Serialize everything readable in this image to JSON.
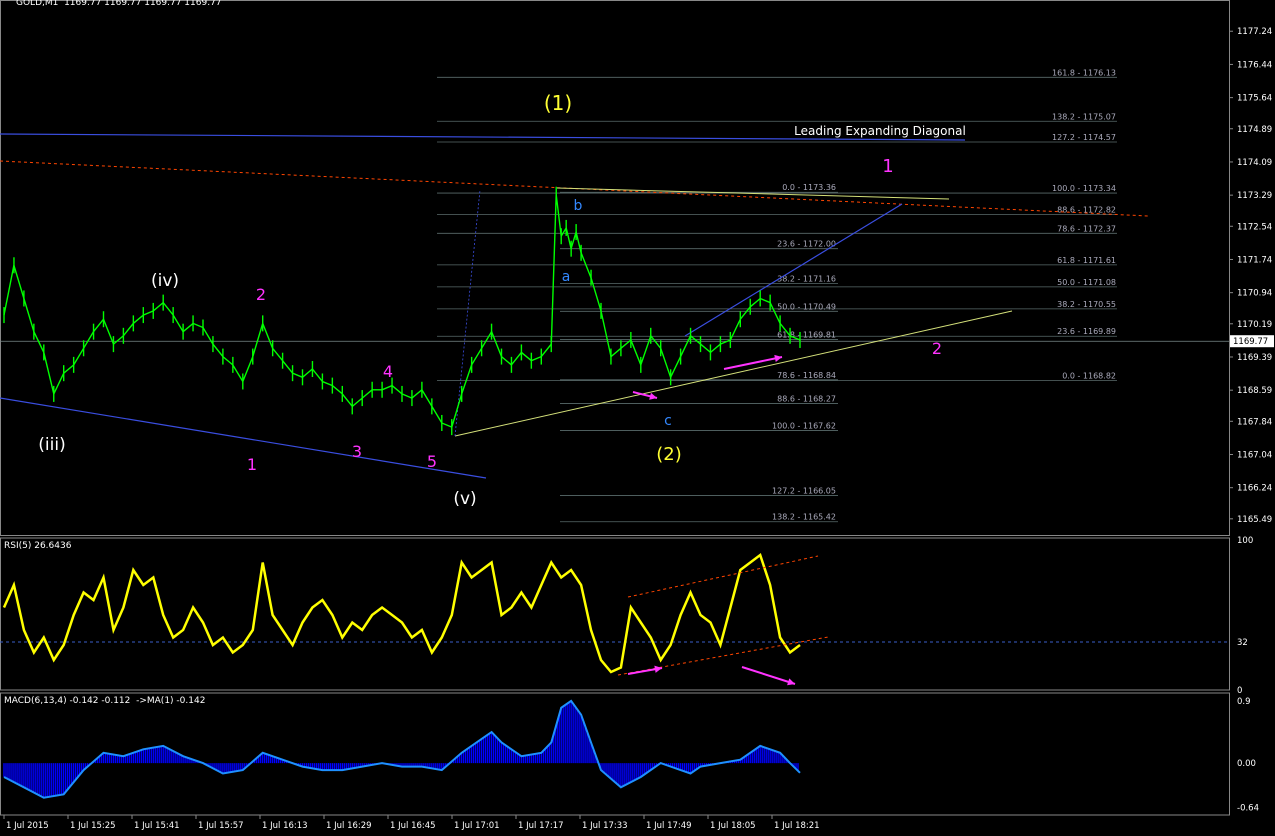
{
  "window": {
    "title": "GOLD,M1  1169.77 1169.77 1169.77 1169.77",
    "rsi_title": "RSI(5) 26.6436",
    "macd_title": "MACD(6,13,4) -0.142 -0.112  ->MA(1) -0.142"
  },
  "colors": {
    "background": "#000000",
    "candle": "#00ff00",
    "grid_fib": "#5a6b6b",
    "rsi_line": "#ffff00",
    "macd_hist": "#0000ff",
    "macd_signal": "#1e90ff",
    "trend_blue": "#3a4ee0",
    "trend_yellow": "#d4e07a",
    "trend_red_dotted": "#ff4500",
    "label_magenta": "#ff33ff",
    "label_yellow": "#ffff33",
    "label_white": "#ffffff",
    "label_blue": "#3388ff",
    "label_red": "#ff3300"
  },
  "chart_data": [
    {
      "type": "line",
      "panel": "price",
      "ylim": [
        1165.1,
        1177.8
      ],
      "y_ticks": [
        "1177.24",
        "1176.44",
        "1175.64",
        "1174.89",
        "1174.09",
        "1173.29",
        "1172.54",
        "1171.74",
        "1170.94",
        "1170.19",
        "1169.39",
        "1168.59",
        "1167.84",
        "1167.04",
        "1166.24",
        "1165.49"
      ],
      "last_price": "1169.77",
      "x_ticks": [
        "1 Jul 2015",
        "1 Jul 15:25",
        "1 Jul 15:41",
        "1 Jul 15:57",
        "1 Jul 16:13",
        "1 Jul 16:29",
        "1 Jul 16:45",
        "1 Jul 17:01",
        "1 Jul 17:17",
        "1 Jul 17:33",
        "1 Jul 17:49",
        "1 Jul 18:05",
        "1 Jul 18:21"
      ],
      "series": [
        {
          "points": [
            [
              0,
              1170.4
            ],
            [
              10,
              1171.6
            ],
            [
              20,
              1170.8
            ],
            [
              30,
              1170.0
            ],
            [
              40,
              1169.5
            ],
            [
              50,
              1168.5
            ],
            [
              60,
              1169.0
            ],
            [
              70,
              1169.2
            ],
            [
              80,
              1169.6
            ],
            [
              90,
              1170.0
            ],
            [
              100,
              1170.3
            ],
            [
              110,
              1169.7
            ],
            [
              120,
              1169.9
            ],
            [
              130,
              1170.2
            ],
            [
              140,
              1170.4
            ],
            [
              150,
              1170.5
            ],
            [
              160,
              1170.7
            ],
            [
              170,
              1170.4
            ],
            [
              180,
              1170.0
            ],
            [
              190,
              1170.2
            ],
            [
              200,
              1170.1
            ],
            [
              210,
              1169.7
            ],
            [
              220,
              1169.4
            ],
            [
              230,
              1169.2
            ],
            [
              240,
              1168.8
            ],
            [
              250,
              1169.4
            ],
            [
              260,
              1170.2
            ],
            [
              270,
              1169.6
            ],
            [
              280,
              1169.3
            ],
            [
              290,
              1169.0
            ],
            [
              300,
              1168.9
            ],
            [
              310,
              1169.1
            ],
            [
              320,
              1168.8
            ],
            [
              330,
              1168.7
            ],
            [
              340,
              1168.5
            ],
            [
              350,
              1168.2
            ],
            [
              360,
              1168.4
            ],
            [
              370,
              1168.6
            ],
            [
              380,
              1168.6
            ],
            [
              390,
              1168.7
            ],
            [
              400,
              1168.5
            ],
            [
              410,
              1168.4
            ],
            [
              420,
              1168.6
            ],
            [
              430,
              1168.2
            ],
            [
              440,
              1167.8
            ],
            [
              450,
              1167.7
            ],
            [
              460,
              1168.5
            ],
            [
              470,
              1169.2
            ],
            [
              480,
              1169.6
            ],
            [
              490,
              1170.0
            ],
            [
              500,
              1169.4
            ],
            [
              510,
              1169.2
            ],
            [
              520,
              1169.5
            ],
            [
              530,
              1169.3
            ],
            [
              540,
              1169.4
            ],
            [
              550,
              1169.7
            ],
            [
              555,
              1173.3
            ],
            [
              560,
              1172.3
            ],
            [
              565,
              1172.5
            ],
            [
              570,
              1172.0
            ],
            [
              575,
              1172.4
            ],
            [
              580,
              1171.9
            ],
            [
              590,
              1171.3
            ],
            [
              600,
              1170.5
            ],
            [
              610,
              1169.4
            ],
            [
              620,
              1169.6
            ],
            [
              630,
              1169.8
            ],
            [
              640,
              1169.2
            ],
            [
              650,
              1169.9
            ],
            [
              660,
              1169.6
            ],
            [
              670,
              1168.9
            ],
            [
              680,
              1169.4
            ],
            [
              690,
              1169.9
            ],
            [
              700,
              1169.7
            ],
            [
              710,
              1169.5
            ],
            [
              720,
              1169.7
            ],
            [
              730,
              1169.8
            ],
            [
              740,
              1170.3
            ],
            [
              750,
              1170.6
            ],
            [
              760,
              1170.8
            ],
            [
              770,
              1170.7
            ],
            [
              780,
              1170.2
            ],
            [
              790,
              1169.9
            ],
            [
              800,
              1169.8
            ]
          ]
        }
      ]
    },
    {
      "type": "line",
      "panel": "rsi",
      "title": "RSI(5) 26.6436",
      "ylim": [
        0,
        100
      ],
      "y_ticks": [
        "100",
        "32",
        "0"
      ],
      "level": 32,
      "series": [
        {
          "points": [
            [
              0,
              55
            ],
            [
              10,
              70
            ],
            [
              20,
              40
            ],
            [
              30,
              25
            ],
            [
              40,
              35
            ],
            [
              50,
              20
            ],
            [
              60,
              30
            ],
            [
              70,
              50
            ],
            [
              80,
              65
            ],
            [
              90,
              60
            ],
            [
              100,
              75
            ],
            [
              110,
              40
            ],
            [
              120,
              55
            ],
            [
              130,
              80
            ],
            [
              140,
              70
            ],
            [
              150,
              75
            ],
            [
              160,
              50
            ],
            [
              170,
              35
            ],
            [
              180,
              40
            ],
            [
              190,
              55
            ],
            [
              200,
              45
            ],
            [
              210,
              30
            ],
            [
              220,
              35
            ],
            [
              230,
              25
            ],
            [
              240,
              30
            ],
            [
              250,
              40
            ],
            [
              260,
              85
            ],
            [
              270,
              50
            ],
            [
              280,
              40
            ],
            [
              290,
              30
            ],
            [
              300,
              45
            ],
            [
              310,
              55
            ],
            [
              320,
              60
            ],
            [
              330,
              50
            ],
            [
              340,
              35
            ],
            [
              350,
              45
            ],
            [
              360,
              40
            ],
            [
              370,
              50
            ],
            [
              380,
              55
            ],
            [
              390,
              50
            ],
            [
              400,
              45
            ],
            [
              410,
              35
            ],
            [
              420,
              40
            ],
            [
              430,
              25
            ],
            [
              440,
              35
            ],
            [
              450,
              50
            ],
            [
              460,
              85
            ],
            [
              470,
              75
            ],
            [
              480,
              80
            ],
            [
              490,
              85
            ],
            [
              500,
              50
            ],
            [
              510,
              55
            ],
            [
              520,
              65
            ],
            [
              530,
              55
            ],
            [
              540,
              70
            ],
            [
              550,
              85
            ],
            [
              560,
              75
            ],
            [
              570,
              80
            ],
            [
              580,
              70
            ],
            [
              590,
              40
            ],
            [
              600,
              20
            ],
            [
              610,
              12
            ],
            [
              620,
              15
            ],
            [
              630,
              55
            ],
            [
              640,
              45
            ],
            [
              650,
              35
            ],
            [
              660,
              20
            ],
            [
              670,
              30
            ],
            [
              680,
              50
            ],
            [
              690,
              65
            ],
            [
              700,
              50
            ],
            [
              710,
              45
            ],
            [
              720,
              30
            ],
            [
              730,
              55
            ],
            [
              740,
              80
            ],
            [
              750,
              85
            ],
            [
              760,
              90
            ],
            [
              770,
              70
            ],
            [
              780,
              35
            ],
            [
              790,
              25
            ],
            [
              800,
              30
            ]
          ]
        }
      ]
    },
    {
      "type": "bar",
      "panel": "macd",
      "title": "MACD(6,13,4) -0.142 -0.112  ->MA(1) -0.142",
      "ylim": [
        -0.75,
        1.0
      ],
      "y_ticks": [
        "0.9",
        "0.00",
        "-0.64"
      ],
      "series": [
        {
          "points": [
            [
              0,
              -0.2
            ],
            [
              20,
              -0.35
            ],
            [
              40,
              -0.5
            ],
            [
              60,
              -0.45
            ],
            [
              80,
              -0.1
            ],
            [
              100,
              0.15
            ],
            [
              120,
              0.1
            ],
            [
              140,
              0.2
            ],
            [
              160,
              0.25
            ],
            [
              180,
              0.1
            ],
            [
              200,
              0.0
            ],
            [
              220,
              -0.15
            ],
            [
              240,
              -0.1
            ],
            [
              260,
              0.15
            ],
            [
              280,
              0.05
            ],
            [
              300,
              -0.05
            ],
            [
              320,
              -0.1
            ],
            [
              340,
              -0.1
            ],
            [
              360,
              -0.05
            ],
            [
              380,
              0.0
            ],
            [
              400,
              -0.05
            ],
            [
              420,
              -0.05
            ],
            [
              440,
              -0.1
            ],
            [
              460,
              0.15
            ],
            [
              480,
              0.35
            ],
            [
              490,
              0.45
            ],
            [
              500,
              0.3
            ],
            [
              520,
              0.1
            ],
            [
              540,
              0.15
            ],
            [
              550,
              0.3
            ],
            [
              560,
              0.8
            ],
            [
              570,
              0.9
            ],
            [
              580,
              0.7
            ],
            [
              590,
              0.3
            ],
            [
              600,
              -0.1
            ],
            [
              620,
              -0.35
            ],
            [
              640,
              -0.2
            ],
            [
              660,
              0.0
            ],
            [
              680,
              -0.1
            ],
            [
              690,
              -0.15
            ],
            [
              700,
              -0.05
            ],
            [
              720,
              0.0
            ],
            [
              740,
              0.05
            ],
            [
              760,
              0.25
            ],
            [
              770,
              0.2
            ],
            [
              780,
              0.15
            ],
            [
              790,
              0.0
            ],
            [
              800,
              -0.14
            ]
          ]
        }
      ]
    }
  ],
  "fib_levels_top": [
    "161.8 - 1176.13",
    "138.2 - 1175.07",
    "127.2 - 1174.57",
    "100.0 - 1173.34",
    "88.6 - 1172.82",
    "78.6 - 1172.37",
    "61.8 - 1171.61",
    "50.0 - 1171.08",
    "38.2 - 1170.55",
    "23.6 - 1169.89",
    "0.0 - 1168.82"
  ],
  "fib_levels_mid": [
    "0.0 - 1173.36",
    "23.6 - 1172.00",
    "38.2 - 1171.16",
    "50.0 - 1170.49",
    "61.8 - 1169.81",
    "78.6 - 1168.84",
    "88.6 - 1168.27",
    "100.0 - 1167.62",
    "127.2 - 1166.05",
    "138.2 - 1165.42"
  ],
  "annotations": {
    "wave1_top": "(1)",
    "wave2_bottom": "(2)",
    "pattern_label": "Leading Expanding Diagonal",
    "one_magenta": "1",
    "two_magenta": "2",
    "iii_white": "(iii)",
    "iv_white": "(iv)",
    "v_white": "(v)",
    "m2": "2",
    "m1": "1",
    "m3": "3",
    "m4": "4",
    "m5": "5",
    "a_blue": "a",
    "b_blue": "b",
    "c_blue": "c"
  }
}
